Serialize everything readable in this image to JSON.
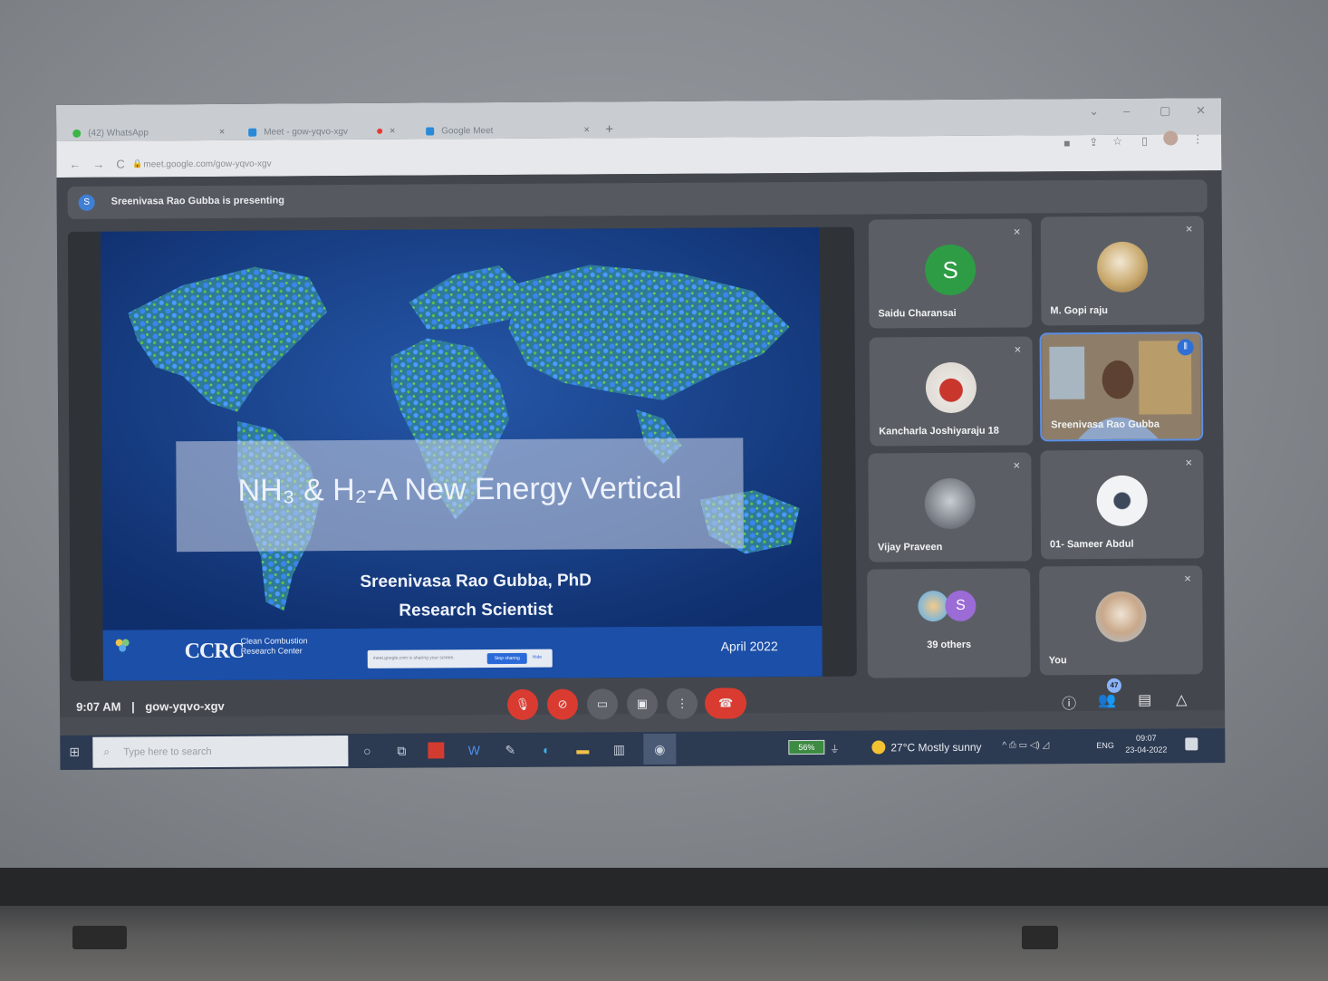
{
  "browser": {
    "tabs": [
      {
        "label": "(42) WhatsApp",
        "close": "×"
      },
      {
        "label": "Meet - gow-yqvo-xgv",
        "close": "×"
      },
      {
        "label": "Google Meet",
        "close": "×"
      }
    ],
    "new_tab": "+",
    "url": "meet.google.com/gow-yqvo-xgv",
    "window_controls": [
      "⌄",
      "–",
      "▢",
      "✕"
    ]
  },
  "meet": {
    "presenting_banner": "Sreenivasa Rao Gubba is presenting",
    "presenter_initial": "S",
    "time": "9:07 AM",
    "separator": "|",
    "meeting_code": "gow-yqvo-xgv",
    "participant_count": "47",
    "participants": [
      {
        "name": "Saidu Charansai",
        "initial": "S",
        "muted": true
      },
      {
        "name": "M. Gopi raju",
        "muted": true
      },
      {
        "name": "Kancharla Joshiyaraju 18",
        "muted": true
      },
      {
        "name": "Sreenivasa Rao Gubba",
        "muted": false,
        "speaking": true
      },
      {
        "name": "Vijay Praveen",
        "muted": true
      },
      {
        "name": "01- Sameer Abdul",
        "muted": true
      },
      {
        "name": "39 others",
        "initial": "S"
      },
      {
        "name": "You",
        "muted": true
      }
    ]
  },
  "slide": {
    "title": "NH₃ & H₂-A New Energy Vertical",
    "author": "Sreenivasa Rao Gubba, PhD",
    "role": "Research Scientist",
    "logo_text": "CCRC",
    "logo_subtitle_line1": "Clean Combustion",
    "logo_subtitle_line2": "Research Center",
    "date": "April 2022",
    "share_message": "meet.google.com is sharing your screen.",
    "stop_sharing": "Stop sharing",
    "hide": "Hide"
  },
  "taskbar": {
    "search_placeholder": "Type here to search",
    "battery": "56%",
    "weather": "27°C  Mostly sunny",
    "language": "ENG",
    "clock_time": "09:07",
    "clock_date": "23-04-2022"
  },
  "colors": {
    "meet_red": "#d93b30",
    "avatar_green": "#2e9c45",
    "avatar_purple": "#9b6bd6",
    "slide_blue": "#173a7e"
  }
}
